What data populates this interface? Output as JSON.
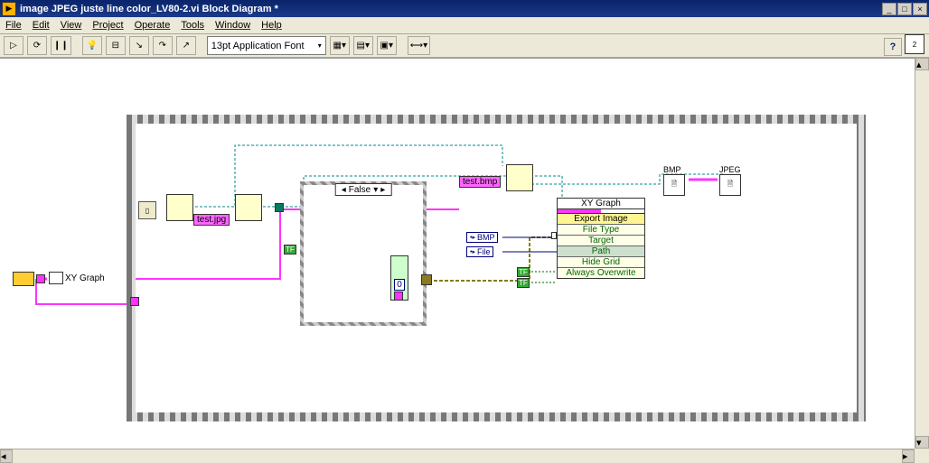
{
  "window": {
    "title": "image JPEG juste line color_LV80-2.vi Block Diagram *"
  },
  "menu": {
    "file": "File",
    "edit": "Edit",
    "view": "View",
    "project": "Project",
    "operate": "Operate",
    "tools": "Tools",
    "window": "Window",
    "help": "Help"
  },
  "toolbar": {
    "font": "13pt Application Font",
    "help_glyph": "?",
    "vi_icon_text": "2"
  },
  "diagram": {
    "xy_graph_label_left": "XY Graph",
    "test_jpg": "test.jpg",
    "test_bmp": "test.bmp",
    "case_selector": "False",
    "case_zero": "0",
    "bmp_ref": "BMP",
    "jpeg_ref": "JPEG",
    "tf": "TF",
    "const_bmp": "BMP",
    "const_file": "File",
    "invoke": {
      "header": "XY Graph",
      "section": "Export Image",
      "rows": [
        "File Type",
        "Target",
        "Path",
        "Hide Grid",
        "Always Overwrite"
      ]
    }
  }
}
